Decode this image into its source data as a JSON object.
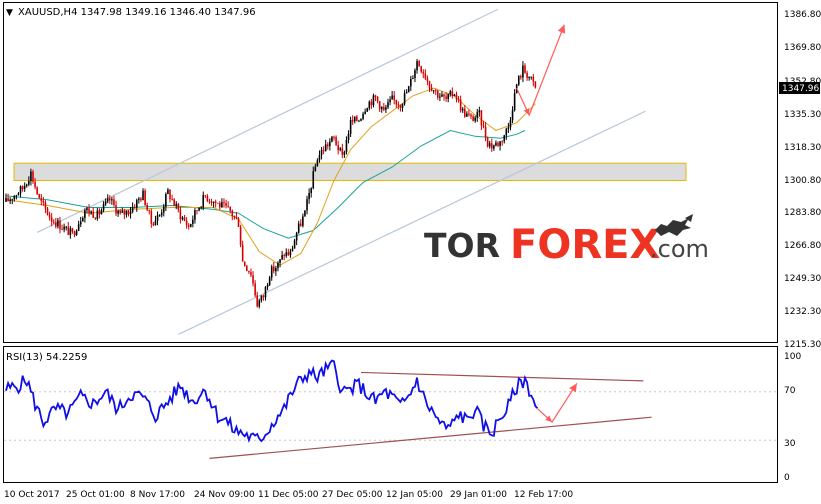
{
  "colors": {
    "bull": "#000000",
    "bear": "#d40000",
    "ma_fast": "#e3a21a",
    "ma_slow": "#1aa39a",
    "channel": "#b8c8d8",
    "zone_fill": "#dcdcdc",
    "zone_border": "#e6b800",
    "rsi": "#1010e6",
    "rsi_trend": "#a05050",
    "forecast": "#ff5a5a",
    "grid_text": "#000000",
    "price_box": "#000000"
  },
  "price_panel": {
    "header": "XAUUSD,H4  1347.98 1349.16 1346.40 1347.96",
    "current_price": "1347.96",
    "y_ticks": [
      "1386.80",
      "1369.80",
      "1352.80",
      "1335.30",
      "1318.30",
      "1300.80",
      "1283.80",
      "1266.80",
      "1249.30",
      "1232.30",
      "1215.30"
    ]
  },
  "rsi_panel": {
    "header": "RSI(13) 54.2259",
    "y_ticks": [
      "100",
      "70",
      "30",
      "0"
    ]
  },
  "x_ticks": [
    "10 Oct 2017",
    "25 Oct 01:00",
    "8 Nov 17:00",
    "24 Nov 09:00",
    "11 Dec 05:00",
    "27 Dec 05:00",
    "12 Jan 05:00",
    "29 Jan 01:00",
    "12 Feb 17:00"
  ],
  "watermark": {
    "part1": "TOR",
    "part2": "FOREX",
    "part3": ".com",
    "icon": "bull-bear-icon"
  },
  "chart_data": {
    "type": "candlestick",
    "symbol": "XAUUSD",
    "timeframe": "H4",
    "ohlc_last": {
      "open": 1347.98,
      "high": 1349.16,
      "low": 1346.4,
      "close": 1347.96
    },
    "price_ylim": [
      1215.3,
      1386.8
    ],
    "rsi_ylim": [
      0,
      100
    ],
    "rsi_period": 13,
    "rsi_last": 54.2259,
    "close_path": [
      [
        0,
        1289
      ],
      [
        8,
        1296
      ],
      [
        12,
        1304
      ],
      [
        16,
        1290
      ],
      [
        22,
        1280
      ],
      [
        27,
        1276
      ],
      [
        32,
        1272
      ],
      [
        38,
        1285
      ],
      [
        44,
        1282
      ],
      [
        50,
        1290
      ],
      [
        55,
        1282
      ],
      [
        60,
        1285
      ],
      [
        66,
        1293
      ],
      [
        70,
        1278
      ],
      [
        74,
        1282
      ],
      [
        78,
        1294
      ],
      [
        84,
        1282
      ],
      [
        88,
        1276
      ],
      [
        92,
        1285
      ],
      [
        96,
        1292
      ],
      [
        102,
        1288
      ],
      [
        108,
        1284
      ],
      [
        112,
        1278
      ],
      [
        114,
        1258
      ],
      [
        118,
        1252
      ],
      [
        121,
        1236
      ],
      [
        124,
        1240
      ],
      [
        127,
        1252
      ],
      [
        131,
        1256
      ],
      [
        134,
        1262
      ],
      [
        137,
        1262
      ],
      [
        140,
        1273
      ],
      [
        144,
        1283
      ],
      [
        146,
        1293
      ],
      [
        150,
        1312
      ],
      [
        154,
        1318
      ],
      [
        158,
        1322
      ],
      [
        162,
        1312
      ],
      [
        166,
        1330
      ],
      [
        170,
        1332
      ],
      [
        174,
        1340
      ],
      [
        178,
        1343
      ],
      [
        182,
        1336
      ],
      [
        186,
        1342
      ],
      [
        190,
        1340
      ],
      [
        194,
        1348
      ],
      [
        198,
        1362
      ],
      [
        201,
        1357
      ],
      [
        204,
        1350
      ],
      [
        208,
        1345
      ],
      [
        212,
        1342
      ],
      [
        216,
        1346
      ],
      [
        220,
        1336
      ],
      [
        224,
        1332
      ],
      [
        228,
        1334
      ],
      [
        232,
        1320
      ],
      [
        234,
        1318
      ],
      [
        238,
        1320
      ],
      [
        242,
        1328
      ],
      [
        246,
        1350
      ],
      [
        249,
        1358
      ],
      [
        252,
        1354
      ],
      [
        255,
        1348
      ]
    ],
    "ma_fast_path": [
      [
        0,
        1290
      ],
      [
        20,
        1287
      ],
      [
        40,
        1283
      ],
      [
        60,
        1285
      ],
      [
        80,
        1286
      ],
      [
        100,
        1286
      ],
      [
        112,
        1280
      ],
      [
        122,
        1263
      ],
      [
        132,
        1256
      ],
      [
        142,
        1262
      ],
      [
        150,
        1278
      ],
      [
        158,
        1300
      ],
      [
        166,
        1316
      ],
      [
        176,
        1328
      ],
      [
        186,
        1336
      ],
      [
        196,
        1344
      ],
      [
        206,
        1348
      ],
      [
        216,
        1344
      ],
      [
        226,
        1334
      ],
      [
        236,
        1326
      ],
      [
        246,
        1330
      ],
      [
        255,
        1340
      ]
    ],
    "ma_slow_path": [
      [
        0,
        1292
      ],
      [
        20,
        1290
      ],
      [
        40,
        1286
      ],
      [
        60,
        1286
      ],
      [
        80,
        1287
      ],
      [
        100,
        1285
      ],
      [
        112,
        1283
      ],
      [
        124,
        1275
      ],
      [
        136,
        1270
      ],
      [
        148,
        1274
      ],
      [
        160,
        1286
      ],
      [
        172,
        1299
      ],
      [
        186,
        1307
      ],
      [
        200,
        1318
      ],
      [
        214,
        1326
      ],
      [
        226,
        1323
      ],
      [
        238,
        1322
      ],
      [
        246,
        1324
      ],
      [
        250,
        1326
      ]
    ],
    "channel_upper": [
      [
        15,
        1273
      ],
      [
        237,
        1389
      ]
    ],
    "channel_lower": [
      [
        83,
        1220
      ],
      [
        308,
        1336
      ]
    ],
    "resistance_zone": [
      1300,
      1309
    ],
    "forecast_price": [
      [
        246,
        1348
      ],
      [
        252,
        1334
      ],
      [
        269,
        1381
      ]
    ],
    "rsi_path": [
      [
        0,
        72
      ],
      [
        6,
        75
      ],
      [
        10,
        80
      ],
      [
        14,
        60
      ],
      [
        18,
        45
      ],
      [
        24,
        56
      ],
      [
        30,
        52
      ],
      [
        36,
        66
      ],
      [
        42,
        60
      ],
      [
        48,
        70
      ],
      [
        54,
        55
      ],
      [
        60,
        68
      ],
      [
        66,
        66
      ],
      [
        72,
        50
      ],
      [
        78,
        62
      ],
      [
        84,
        75
      ],
      [
        90,
        62
      ],
      [
        96,
        72
      ],
      [
        102,
        50
      ],
      [
        106,
        46
      ],
      [
        110,
        38
      ],
      [
        114,
        36
      ],
      [
        118,
        32
      ],
      [
        122,
        30
      ],
      [
        126,
        38
      ],
      [
        130,
        48
      ],
      [
        134,
        56
      ],
      [
        138,
        70
      ],
      [
        142,
        80
      ],
      [
        146,
        86
      ],
      [
        150,
        82
      ],
      [
        154,
        88
      ],
      [
        158,
        92
      ],
      [
        162,
        70
      ],
      [
        166,
        72
      ],
      [
        170,
        76
      ],
      [
        174,
        68
      ],
      [
        178,
        62
      ],
      [
        182,
        70
      ],
      [
        186,
        66
      ],
      [
        190,
        58
      ],
      [
        194,
        66
      ],
      [
        198,
        80
      ],
      [
        202,
        62
      ],
      [
        206,
        52
      ],
      [
        210,
        42
      ],
      [
        214,
        40
      ],
      [
        218,
        52
      ],
      [
        222,
        46
      ],
      [
        226,
        56
      ],
      [
        230,
        42
      ],
      [
        234,
        36
      ],
      [
        238,
        48
      ],
      [
        242,
        58
      ],
      [
        246,
        74
      ],
      [
        250,
        80
      ],
      [
        254,
        64
      ],
      [
        256,
        54
      ]
    ],
    "rsi_trend_upper": [
      [
        171,
        86
      ],
      [
        307,
        79
      ]
    ],
    "rsi_trend_lower": [
      [
        98,
        15
      ],
      [
        311,
        49
      ]
    ],
    "forecast_rsi": [
      [
        256,
        56
      ],
      [
        263,
        45
      ],
      [
        275,
        77
      ]
    ]
  }
}
